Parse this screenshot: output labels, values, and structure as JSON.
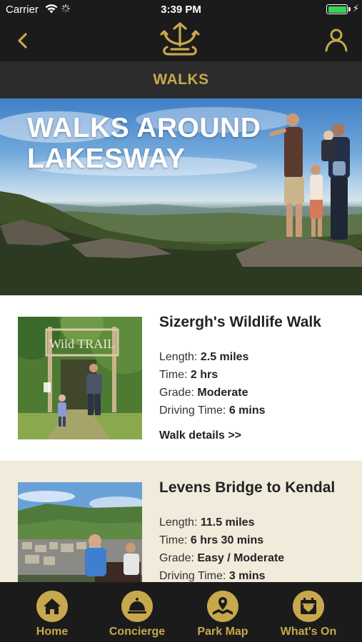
{
  "status_bar": {
    "carrier": "Carrier",
    "time": "3:39 PM",
    "battery_icon": "battery-charging-icon"
  },
  "nav": {
    "back_icon": "chevron-left-icon",
    "logo_icon": "crown-trident-logo",
    "profile_icon": "person-icon"
  },
  "section": {
    "title": "WALKS"
  },
  "hero": {
    "title_line1": "WALKS AROUND",
    "title_line2": "LAKESWAY"
  },
  "walks": [
    {
      "name": "Sizergh's Wildlife Walk",
      "length_label": "Length:",
      "length": "2.5 miles",
      "time_label": "Time:",
      "time": "2 hrs",
      "grade_label": "Grade:",
      "grade": "Moderate",
      "driving_label": "Driving Time:",
      "driving": "6 mins",
      "link": "Walk details >>",
      "thumb_sign_text": "Wild TRAIL"
    },
    {
      "name": "Levens Bridge to Kendal",
      "length_label": "Length:",
      "length": "11.5 miles",
      "time_label": "Time:",
      "time": "6 hrs 30 mins",
      "grade_label": "Grade:",
      "grade": "Easy / Moderate",
      "driving_label": "Driving Time:",
      "driving": "3 mins"
    }
  ],
  "tabs": [
    {
      "label": "Home",
      "icon": "home-icon"
    },
    {
      "label": "Concierge",
      "icon": "service-bell-icon"
    },
    {
      "label": "Park Map",
      "icon": "map-pin-icon"
    },
    {
      "label": "What's On",
      "icon": "calendar-heart-icon"
    }
  ],
  "colors": {
    "accent_gold": "#c7a84d",
    "bar_dark": "#1b1b1b",
    "section_dark": "#2c2c2c",
    "card_alt": "#f1ebdc"
  }
}
